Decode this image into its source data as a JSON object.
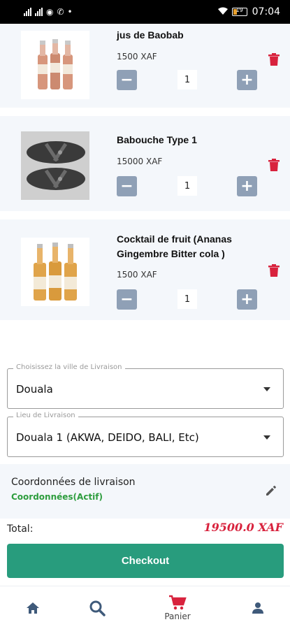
{
  "status_bar": {
    "time": "07:04",
    "battery": "19"
  },
  "cart": {
    "items": [
      {
        "name": "jus de Baobab",
        "price": "1500 XAF",
        "qty": "1"
      },
      {
        "name": "Babouche Type 1",
        "price": "15000 XAF",
        "qty": "1"
      },
      {
        "name": "Cocktail de fruit (Ananas Gingembre Bitter cola )",
        "price": "1500 XAF",
        "qty": "1"
      }
    ]
  },
  "delivery": {
    "city_label": "Choisissez  la ville de Livraison",
    "city_value": "Douala",
    "place_label": "Lieu de Livraison",
    "place_value": "Douala 1 (AKWA, DEIDO, BALI, Etc)",
    "coords_title": "Coordonnées de livraison",
    "coords_status": "Coordonnées(Actif)"
  },
  "total": {
    "label": "Total:",
    "value": "19500.0 XAF"
  },
  "checkout": {
    "label": "Checkout"
  },
  "nav": {
    "cart_label": "Panier"
  },
  "colors": {
    "accent": "#289c7d",
    "danger": "#d8223d",
    "qty_button": "#8fa0b6",
    "status_green": "#2e9d3e"
  },
  "icons": [
    "home-icon",
    "search-icon",
    "cart-icon",
    "account-icon",
    "trash-icon",
    "edit-icon",
    "minus-icon",
    "plus-icon"
  ]
}
